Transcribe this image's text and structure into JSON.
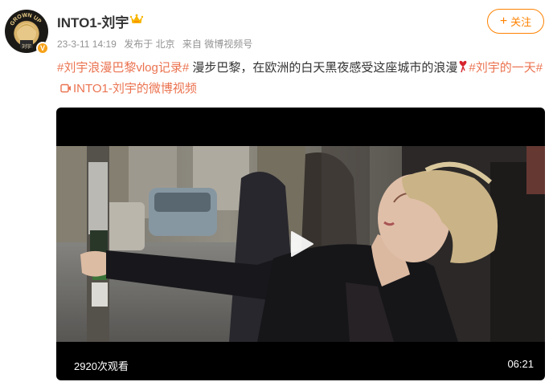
{
  "user": {
    "name": "INTO1-刘宇",
    "avatar_text": "GROWN UP",
    "verified_badge": "V"
  },
  "meta": {
    "time": "23-3-11 14:19",
    "posted_from_label": "发布于 北京",
    "source_label": "来自 微博视频号"
  },
  "follow_button": {
    "plus": "+",
    "label": "关注"
  },
  "post": {
    "tag1": "#刘宇浪漫巴黎vlog记录#",
    "text": " 漫步巴黎，在欧洲的白天黑夜感受这座城市的浪漫",
    "tag2": "#刘宇的一天#",
    "video_link": "INTO1-刘宇的微博视频"
  },
  "video": {
    "views": "2920次观看",
    "duration": "06:21"
  },
  "colors": {
    "accent_orange": "#ff8200",
    "tag_color": "#eb7350",
    "meta_gray": "#939393"
  },
  "icons": [
    "crown-icon",
    "heart-icon",
    "video-link-icon",
    "play-icon"
  ]
}
